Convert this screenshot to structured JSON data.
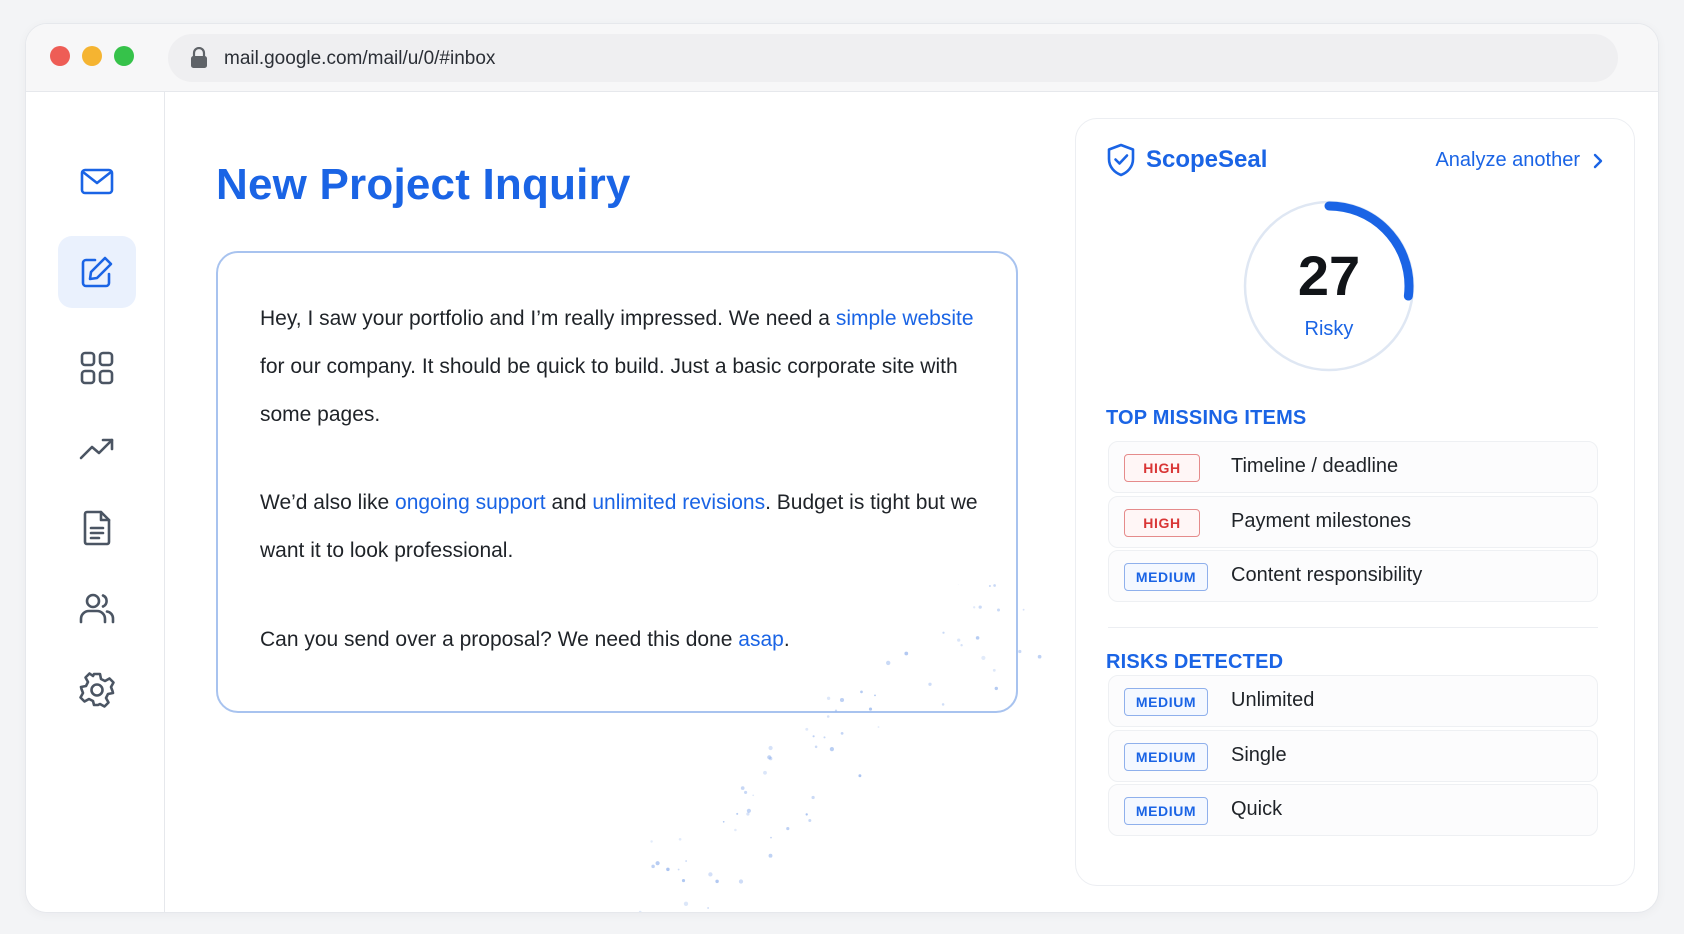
{
  "browser": {
    "url": "mail.google.com/mail/u/0/#inbox"
  },
  "sidebar": {
    "items": [
      {
        "icon": "mail-icon",
        "active": false
      },
      {
        "icon": "compose-icon",
        "active": true
      },
      {
        "icon": "grid-icon",
        "active": false
      },
      {
        "icon": "trending-icon",
        "active": false
      },
      {
        "icon": "document-icon",
        "active": false
      },
      {
        "icon": "users-icon",
        "active": false
      },
      {
        "icon": "gear-icon",
        "active": false
      }
    ]
  },
  "email": {
    "title": "New Project Inquiry",
    "p1_a": "Hey, I saw your portfolio and I’m really impressed. We need a ",
    "p1_hl": "simple website",
    "p1_b": " for our company. It should be quick to build. Just a basic corporate site with some pages.",
    "p2_a": "We’d also like ",
    "p2_hl1": "ongoing support",
    "p2_b": " and ",
    "p2_hl2": "unlimited revisions",
    "p2_c": ". Budget is tight but we want it to look professional.",
    "p3_a": "Can you send over a proposal? We need this done ",
    "p3_hl": "asap",
    "p3_b": "."
  },
  "panel": {
    "brand": "ScopeSeal",
    "analyze_label": "Analyze another",
    "score": "27",
    "score_value": 27,
    "score_max": 100,
    "score_label": "Risky",
    "missing_title": "TOP MISSING ITEMS",
    "missing": [
      {
        "severity": "HIGH",
        "label": "Timeline / deadline"
      },
      {
        "severity": "HIGH",
        "label": "Payment milestones"
      },
      {
        "severity": "MEDIUM",
        "label": "Content responsibility"
      }
    ],
    "risks_title": "RISKS DETECTED",
    "risks": [
      {
        "severity": "MEDIUM",
        "label": "Unlimited"
      },
      {
        "severity": "MEDIUM",
        "label": "Single"
      },
      {
        "severity": "MEDIUM",
        "label": "Quick"
      }
    ]
  },
  "colors": {
    "accent": "#1a64e5",
    "high": "#d93636",
    "gauge_track": "#dfe7f3"
  }
}
